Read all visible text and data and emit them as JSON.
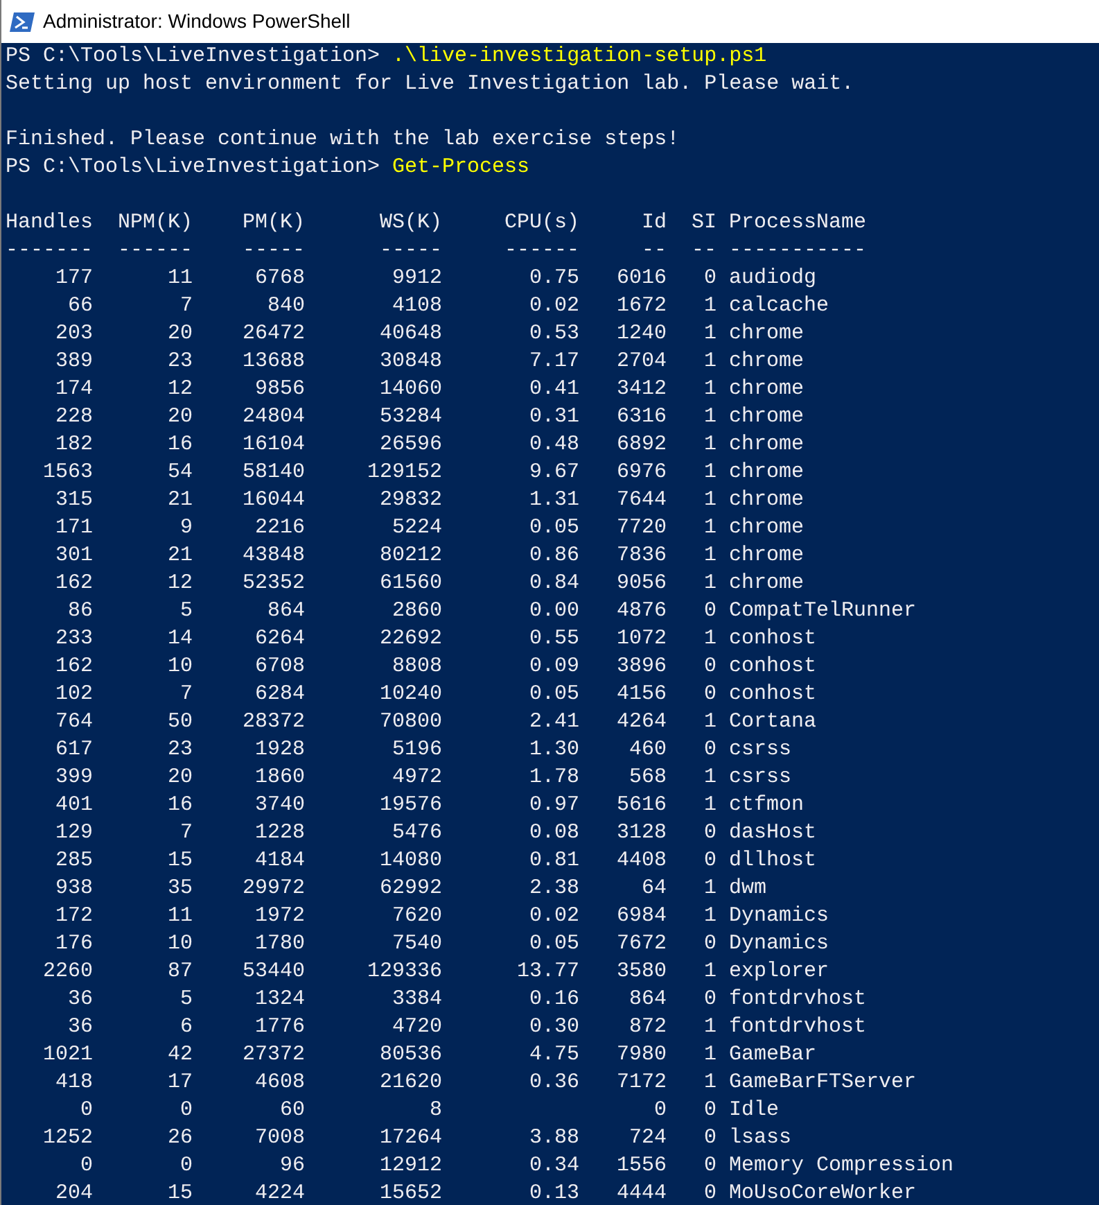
{
  "window": {
    "title": "Administrator: Windows PowerShell"
  },
  "console": {
    "lines": [
      {
        "kind": "command",
        "prompt": "PS C:\\Tools\\LiveInvestigation>",
        "command": ".\\live-investigation-setup.ps1"
      },
      {
        "kind": "output",
        "text": "Setting up host environment for Live Investigation lab. Please wait."
      },
      {
        "kind": "blank"
      },
      {
        "kind": "output",
        "text": "Finished. Please continue with the lab exercise steps!"
      },
      {
        "kind": "command",
        "prompt": "PS C:\\Tools\\LiveInvestigation>",
        "command": "Get-Process"
      },
      {
        "kind": "blank"
      }
    ]
  },
  "table": {
    "columns": [
      {
        "header": "Handles",
        "rule": "-------"
      },
      {
        "header": "NPM(K)",
        "rule": "------"
      },
      {
        "header": "PM(K)",
        "rule": "-----"
      },
      {
        "header": "WS(K)",
        "rule": "-----"
      },
      {
        "header": "CPU(s)",
        "rule": "------"
      },
      {
        "header": "Id",
        "rule": "--"
      },
      {
        "header": "SI",
        "rule": "--"
      },
      {
        "header": "ProcessName",
        "rule": "-----------"
      }
    ],
    "rows": [
      [
        "177",
        "11",
        "6768",
        "9912",
        "0.75",
        "6016",
        "0",
        "audiodg"
      ],
      [
        "66",
        "7",
        "840",
        "4108",
        "0.02",
        "1672",
        "1",
        "calcache"
      ],
      [
        "203",
        "20",
        "26472",
        "40648",
        "0.53",
        "1240",
        "1",
        "chrome"
      ],
      [
        "389",
        "23",
        "13688",
        "30848",
        "7.17",
        "2704",
        "1",
        "chrome"
      ],
      [
        "174",
        "12",
        "9856",
        "14060",
        "0.41",
        "3412",
        "1",
        "chrome"
      ],
      [
        "228",
        "20",
        "24804",
        "53284",
        "0.31",
        "6316",
        "1",
        "chrome"
      ],
      [
        "182",
        "16",
        "16104",
        "26596",
        "0.48",
        "6892",
        "1",
        "chrome"
      ],
      [
        "1563",
        "54",
        "58140",
        "129152",
        "9.67",
        "6976",
        "1",
        "chrome"
      ],
      [
        "315",
        "21",
        "16044",
        "29832",
        "1.31",
        "7644",
        "1",
        "chrome"
      ],
      [
        "171",
        "9",
        "2216",
        "5224",
        "0.05",
        "7720",
        "1",
        "chrome"
      ],
      [
        "301",
        "21",
        "43848",
        "80212",
        "0.86",
        "7836",
        "1",
        "chrome"
      ],
      [
        "162",
        "12",
        "52352",
        "61560",
        "0.84",
        "9056",
        "1",
        "chrome"
      ],
      [
        "86",
        "5",
        "864",
        "2860",
        "0.00",
        "4876",
        "0",
        "CompatTelRunner"
      ],
      [
        "233",
        "14",
        "6264",
        "22692",
        "0.55",
        "1072",
        "1",
        "conhost"
      ],
      [
        "162",
        "10",
        "6708",
        "8808",
        "0.09",
        "3896",
        "0",
        "conhost"
      ],
      [
        "102",
        "7",
        "6284",
        "10240",
        "0.05",
        "4156",
        "0",
        "conhost"
      ],
      [
        "764",
        "50",
        "28372",
        "70800",
        "2.41",
        "4264",
        "1",
        "Cortana"
      ],
      [
        "617",
        "23",
        "1928",
        "5196",
        "1.30",
        "460",
        "0",
        "csrss"
      ],
      [
        "399",
        "20",
        "1860",
        "4972",
        "1.78",
        "568",
        "1",
        "csrss"
      ],
      [
        "401",
        "16",
        "3740",
        "19576",
        "0.97",
        "5616",
        "1",
        "ctfmon"
      ],
      [
        "129",
        "7",
        "1228",
        "5476",
        "0.08",
        "3128",
        "0",
        "dasHost"
      ],
      [
        "285",
        "15",
        "4184",
        "14080",
        "0.81",
        "4408",
        "0",
        "dllhost"
      ],
      [
        "938",
        "35",
        "29972",
        "62992",
        "2.38",
        "64",
        "1",
        "dwm"
      ],
      [
        "172",
        "11",
        "1972",
        "7620",
        "0.02",
        "6984",
        "1",
        "Dynamics"
      ],
      [
        "176",
        "10",
        "1780",
        "7540",
        "0.05",
        "7672",
        "0",
        "Dynamics"
      ],
      [
        "2260",
        "87",
        "53440",
        "129336",
        "13.77",
        "3580",
        "1",
        "explorer"
      ],
      [
        "36",
        "5",
        "1324",
        "3384",
        "0.16",
        "864",
        "0",
        "fontdrvhost"
      ],
      [
        "36",
        "6",
        "1776",
        "4720",
        "0.30",
        "872",
        "1",
        "fontdrvhost"
      ],
      [
        "1021",
        "42",
        "27372",
        "80536",
        "4.75",
        "7980",
        "1",
        "GameBar"
      ],
      [
        "418",
        "17",
        "4608",
        "21620",
        "0.36",
        "7172",
        "1",
        "GameBarFTServer"
      ],
      [
        "0",
        "0",
        "60",
        "8",
        null,
        "0",
        "0",
        "Idle"
      ],
      [
        "1252",
        "26",
        "7008",
        "17264",
        "3.88",
        "724",
        "0",
        "lsass"
      ],
      [
        "0",
        "0",
        "96",
        "12912",
        "0.34",
        "1556",
        "0",
        "Memory Compression"
      ],
      [
        "204",
        "15",
        "4224",
        "15652",
        "0.13",
        "4444",
        "0",
        "MoUsoCoreWorker"
      ]
    ]
  }
}
